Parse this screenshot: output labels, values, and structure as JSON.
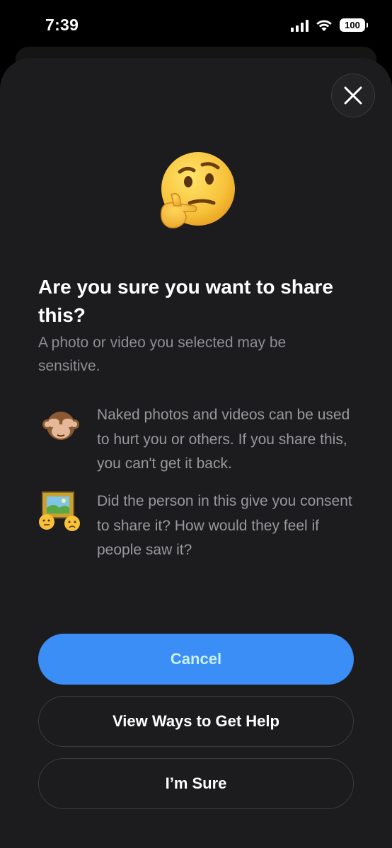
{
  "status_bar": {
    "time": "7:39",
    "battery": "100",
    "icons": [
      "signal-icon",
      "wifi-icon",
      "battery-icon"
    ]
  },
  "sheet": {
    "close_icon": "close-icon",
    "hero_emoji": "thinking-face",
    "title": "Are you sure you want to share this?",
    "subtitle": "A photo or video you selected may be sensitive.",
    "bullets": [
      {
        "icon": "see-no-evil-monkey-icon",
        "text": "Naked photos and videos can be used to hurt you or others. If you share this, you can't get it back."
      },
      {
        "icon": "framed-picture-worried-faces-icon",
        "text": "Did the person in this give you consent to share it? How would they feel if people saw it?"
      }
    ]
  },
  "buttons": {
    "cancel": "Cancel",
    "view_help": "View Ways to Get Help",
    "im_sure": "I’m Sure"
  },
  "colors": {
    "sheet_background": "#1c1c1e",
    "primary_button": "#3b8ef5",
    "primary_button_text": "#c8f1ff",
    "secondary_text": "#8e8e93"
  }
}
